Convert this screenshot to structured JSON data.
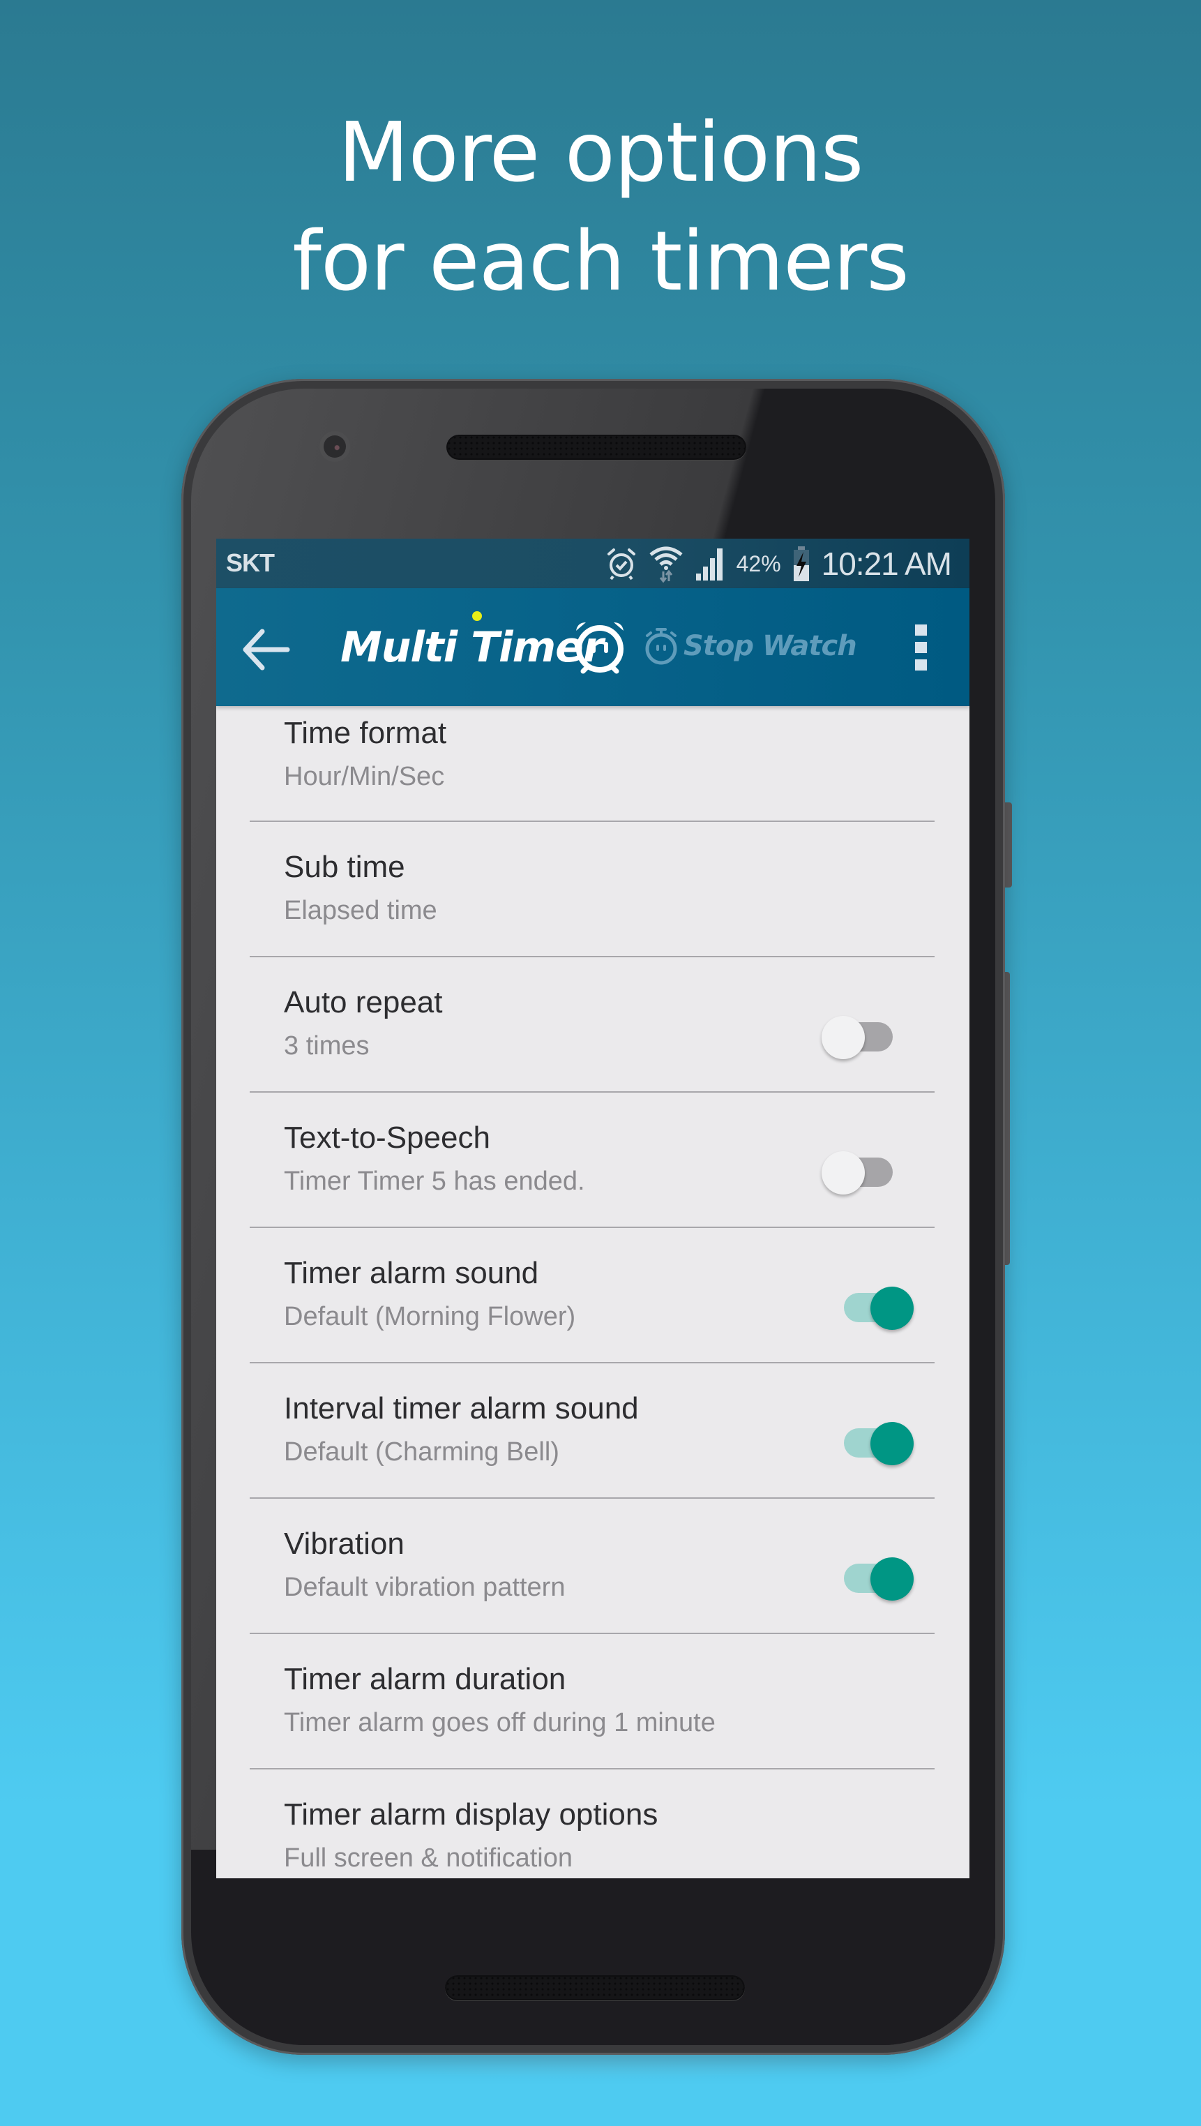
{
  "headline": {
    "line1": "More options",
    "line2": "for each timers"
  },
  "status_bar": {
    "carrier": "SKT",
    "icons": [
      "alarm-check-icon",
      "wifi-data-icon",
      "signal-icon",
      "battery-charging-icon"
    ],
    "battery_percent": "42%",
    "time": "10:21 AM"
  },
  "app_bar": {
    "back_icon": "arrow-left-icon",
    "title": "Multi Timer",
    "logo_icon": "alarm-clock-face-icon",
    "secondary_tab_icon": "stopwatch-icon",
    "secondary_tab_label": "Stop Watch",
    "menu_icon": "more-vertical-icon",
    "colors": {
      "bar": "#076289",
      "status": "#1b4d64",
      "logo_dot": "#e8ee17",
      "secondary": "#5f9cbb"
    }
  },
  "settings": [
    {
      "title": "Time format",
      "subtitle": "Hour/Min/Sec",
      "toggle": null
    },
    {
      "title": "Sub time",
      "subtitle": "Elapsed time",
      "toggle": null
    },
    {
      "title": "Auto repeat",
      "subtitle": "3 times",
      "toggle": false
    },
    {
      "title": "Text-to-Speech",
      "subtitle": "Timer Timer 5 has ended.",
      "toggle": false
    },
    {
      "title": "Timer alarm sound",
      "subtitle": "Default (Morning Flower)",
      "toggle": true
    },
    {
      "title": "Interval timer alarm sound",
      "subtitle": "Default (Charming Bell)",
      "toggle": true
    },
    {
      "title": "Vibration",
      "subtitle": "Default vibration pattern",
      "toggle": true
    },
    {
      "title": "Timer alarm duration",
      "subtitle": "Timer alarm goes off during 1 minute",
      "toggle": null
    },
    {
      "title": "Timer alarm display options",
      "subtitle": "Full screen & notification",
      "toggle": null
    }
  ],
  "colors": {
    "toggle_on_thumb": "#009684",
    "toggle_on_track": "#9fd4cf",
    "toggle_off_thumb": "#f2f2f3",
    "toggle_off_track": "#a6a5a8",
    "list_bg": "#ebeaec",
    "bg_top": "#2b7a91",
    "bg_bottom": "#4ecbf1"
  }
}
